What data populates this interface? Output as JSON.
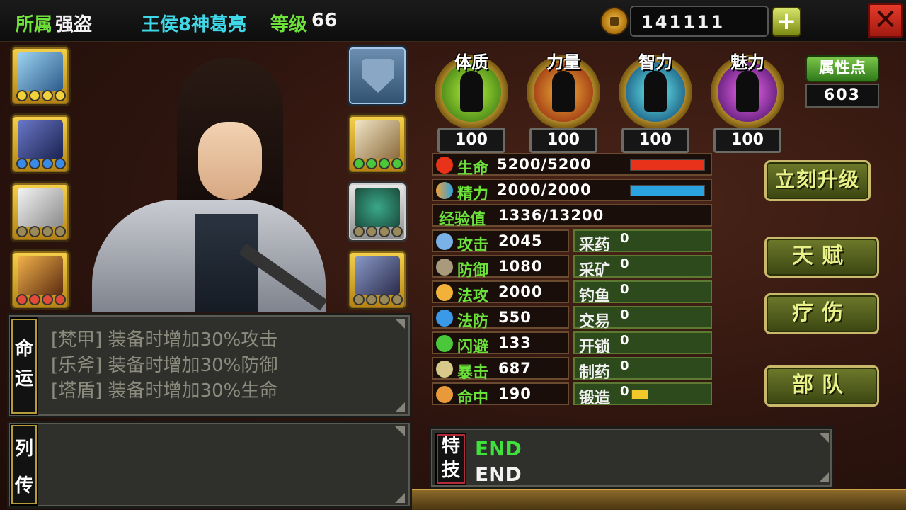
{
  "header": {
    "faction_label": "所属",
    "faction": "强盗",
    "hero_name": "王侯8神葛亮",
    "level_label": "等级",
    "level": "66",
    "gold": "141111",
    "add_label": "+",
    "close_label": "✕"
  },
  "attributes": {
    "items": [
      {
        "label": "体质",
        "value": "100"
      },
      {
        "label": "力量",
        "value": "100"
      },
      {
        "label": "智力",
        "value": "100"
      },
      {
        "label": "魅力",
        "value": "100"
      }
    ],
    "points_label": "属性点",
    "points": "603"
  },
  "vitals": {
    "hp": {
      "label": "生命",
      "value": "5200/5200",
      "fraction": 1.0
    },
    "mp": {
      "label": "精力",
      "value": "2000/2000",
      "fraction": 1.0
    },
    "exp": {
      "label": "经验值",
      "value": "1336/13200",
      "fraction": 0.1
    }
  },
  "stats": [
    {
      "label": "攻击",
      "value": "2045"
    },
    {
      "label": "防御",
      "value": "1080"
    },
    {
      "label": "法攻",
      "value": "2000"
    },
    {
      "label": "法防",
      "value": "550"
    },
    {
      "label": "闪避",
      "value": "133"
    },
    {
      "label": "暴击",
      "value": "687"
    },
    {
      "label": "命中",
      "value": "190"
    }
  ],
  "skills": [
    {
      "label": "采药",
      "value": "0"
    },
    {
      "label": "采矿",
      "value": "0"
    },
    {
      "label": "钓鱼",
      "value": "0"
    },
    {
      "label": "交易",
      "value": "0"
    },
    {
      "label": "开锁",
      "value": "0"
    },
    {
      "label": "制药",
      "value": "0"
    },
    {
      "label": "锻造",
      "value": "0",
      "progress": 0.5
    }
  ],
  "buttons": {
    "upgrade": "立刻升级",
    "talent": "天赋",
    "heal": "疗伤",
    "troops": "部队"
  },
  "fate": {
    "tag_top": "命",
    "tag_bottom": "运",
    "lines": [
      "[梵甲] 装备时增加30%攻击",
      "[乐斧] 装备时增加30%防御",
      "[塔盾] 装备时增加30%生命"
    ]
  },
  "biography": {
    "tag_top": "列",
    "tag_bottom": "传"
  },
  "special": {
    "tag_top": "特",
    "tag_bottom": "技",
    "line1": "END",
    "line2": "END"
  },
  "colors": {
    "accent_green": "#6ee23a",
    "accent_cyan": "#3fd8e8",
    "hp_bar": "#e8321a",
    "mp_bar": "#2aa3e0"
  }
}
